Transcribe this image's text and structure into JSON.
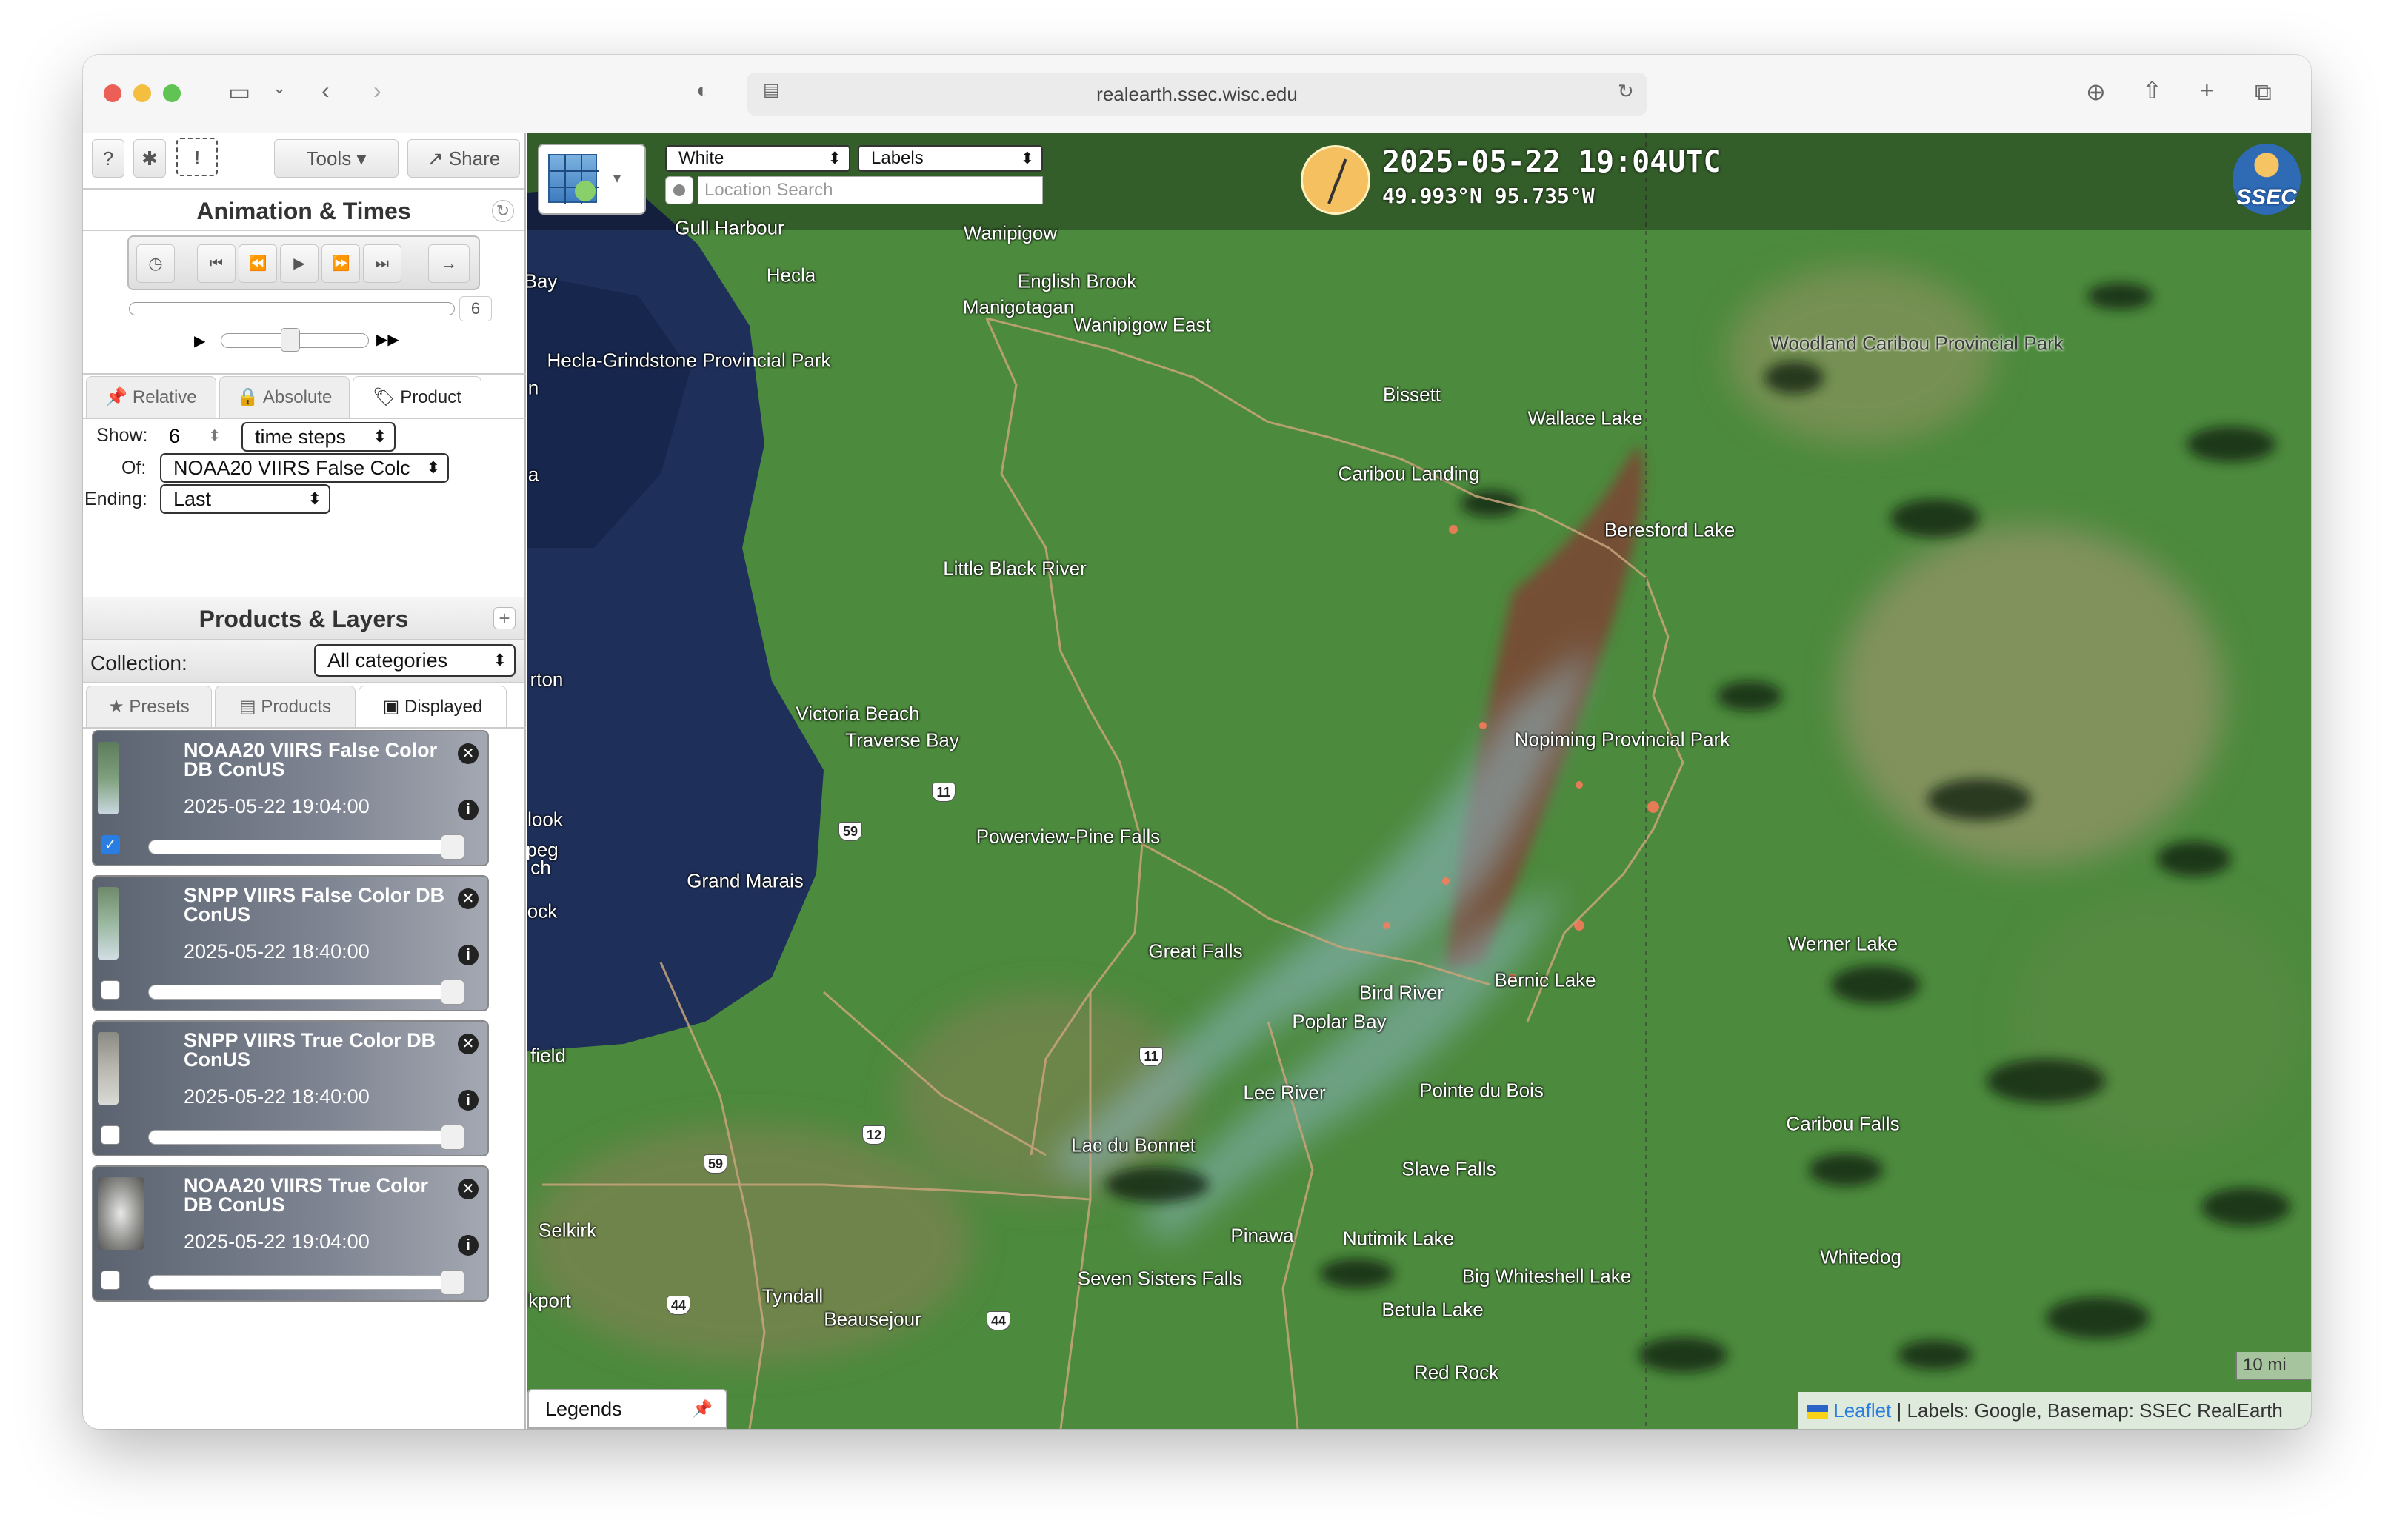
{
  "browser": {
    "url": "realearth.ssec.wisc.edu"
  },
  "toolbar": {
    "help": "?",
    "settings": "✱",
    "alert": "!",
    "tools": "Tools",
    "share": "Share"
  },
  "animation": {
    "title": "Animation & Times",
    "frame_count": "6"
  },
  "time_tabs": {
    "relative": "Relative",
    "absolute": "Absolute",
    "product": "Product"
  },
  "product_form": {
    "show_label": "Show:",
    "show_value": "6",
    "steps": "time steps",
    "of_label": "Of:",
    "of_value": "NOAA20 VIIRS False Colc",
    "ending_label": "Ending:",
    "ending_value": "Last"
  },
  "products": {
    "title": "Products & Layers",
    "collection_label": "Collection:",
    "collection_value": "All categories"
  },
  "layer_tabs": {
    "presets": "Presets",
    "products": "Products",
    "displayed": "Displayed"
  },
  "layers": [
    {
      "name": "NOAA20 VIIRS False Color DB ConUS",
      "time": "2025-05-22 19:04:00",
      "checked": true
    },
    {
      "name": "SNPP VIIRS False Color DB ConUS",
      "time": "2025-05-22 18:40:00",
      "checked": false
    },
    {
      "name": "SNPP VIIRS True Color DB ConUS",
      "time": "2025-05-22 18:40:00",
      "checked": false
    },
    {
      "name": "NOAA20 VIIRS True Color DB ConUS",
      "time": "2025-05-22 19:04:00",
      "checked": false
    }
  ],
  "map_header": {
    "basemap": "White",
    "overlay": "Labels",
    "search_placeholder": "Location Search",
    "datetime": "2025-05-22 19:04UTC",
    "coords": "49.993°N 95.735°W",
    "logo": "SSEC"
  },
  "legend": "Legends",
  "scale": "10 mi",
  "attribution": {
    "leaflet": "Leaflet",
    "rest": " | Labels: Google, Basemap: SSEC RealEarth"
  },
  "places": [
    "Gull Harbour",
    "Wanipigow",
    "Hecla",
    "English Brook",
    "Manigotagan",
    "Wanipigow East",
    "Bay",
    "Hecla-Grindstone Provincial Park",
    "Woodland Caribou Provincial Park",
    "Bissett",
    "Wallace Lake",
    "Caribou Landing",
    "Beresford Lake",
    "Little Black River",
    "Nopiming Provincial Park",
    "Victoria Beach",
    "Traverse Bay",
    "Powerview-Pine Falls",
    "Grand Marais",
    "Great Falls",
    "Werner Lake",
    "Bernic Lake",
    "Bird River",
    "Poplar Bay",
    "Lee River",
    "Pointe du Bois",
    "Lac du Bonnet",
    "Slave Falls",
    "Caribou Falls",
    "Pinawa",
    "Nutimik Lake",
    "Seven Sisters Falls",
    "Whitedog",
    "Big Whiteshell Lake",
    "Selkirk",
    "Tyndall",
    "Beausejour",
    "Betula Lake",
    "Red Rock",
    "rton",
    "look",
    "peg",
    "ch",
    "ock",
    "field",
    "kport",
    "a",
    "n"
  ],
  "routes": [
    "11",
    "59",
    "11",
    "12",
    "59",
    "44",
    "44"
  ],
  "colors": {
    "water": "#1e2f5a",
    "forest": "#4c8a3d",
    "burn": "#7a4a35",
    "smoke": "#8fb8c9",
    "accent": "#2a7de1"
  }
}
